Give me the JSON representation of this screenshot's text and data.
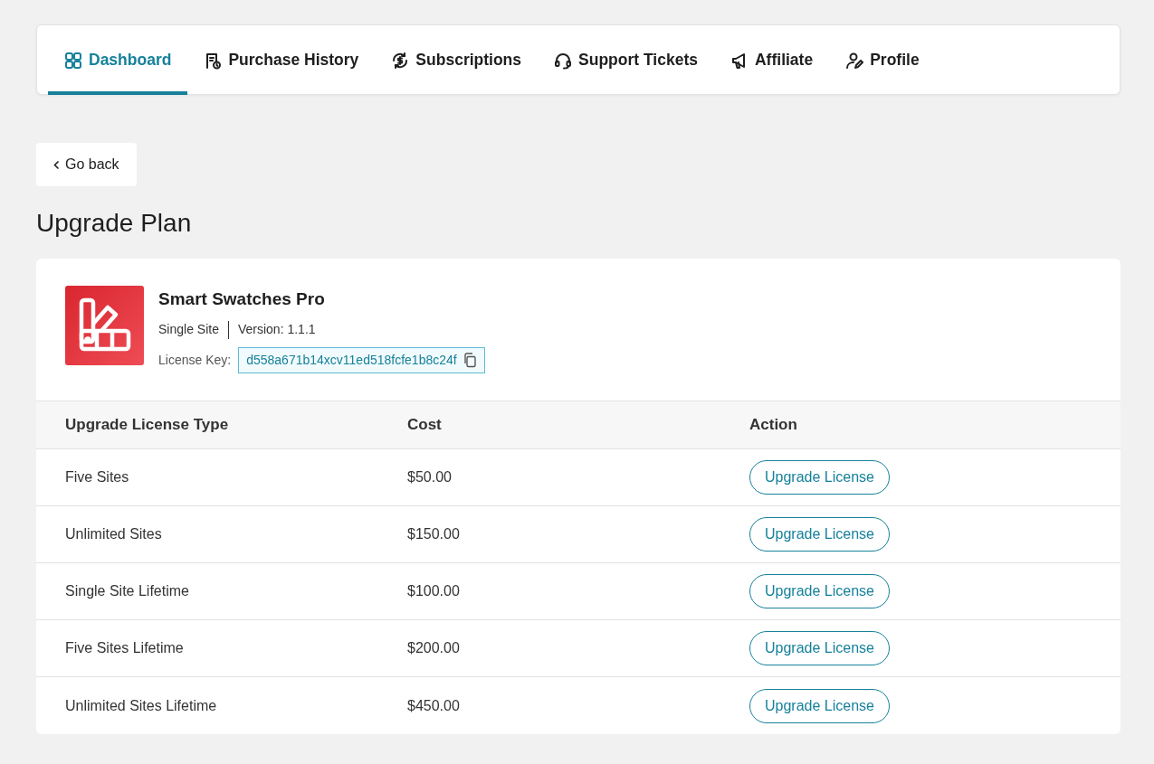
{
  "tabs": [
    {
      "label": "Dashboard",
      "selected": true
    },
    {
      "label": "Purchase History",
      "selected": false
    },
    {
      "label": "Subscriptions",
      "selected": false
    },
    {
      "label": "Support Tickets",
      "selected": false
    },
    {
      "label": "Affiliate",
      "selected": false
    },
    {
      "label": "Profile",
      "selected": false
    }
  ],
  "back_button": {
    "label": "Go back"
  },
  "page_title": "Upgrade Plan",
  "product": {
    "name": "Smart Swatches Pro",
    "license_type": "Single Site",
    "version": "Version: 1.1.1",
    "license_key_label": "License Key:",
    "license_key": "d558a671b14xcv11ed518fcfe1b8c24f"
  },
  "table": {
    "columns": [
      "Upgrade License Type",
      "Cost",
      "Action"
    ],
    "rows": [
      {
        "type": "Five Sites",
        "cost": "$50.00",
        "action": "Upgrade License"
      },
      {
        "type": "Unlimited Sites",
        "cost": "$150.00",
        "action": "Upgrade License"
      },
      {
        "type": "Single Site Lifetime",
        "cost": "$100.00",
        "action": "Upgrade License"
      },
      {
        "type": "Five Sites Lifetime",
        "cost": "$200.00",
        "action": "Upgrade License"
      },
      {
        "type": "Unlimited Sites Lifetime",
        "cost": "$450.00",
        "action": "Upgrade License"
      }
    ]
  }
}
